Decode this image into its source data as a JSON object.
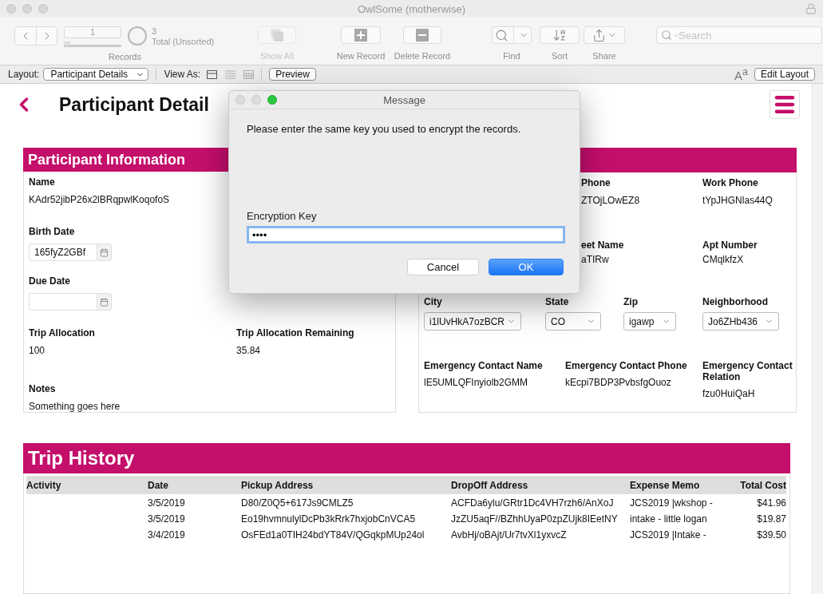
{
  "window": {
    "title": "OwlSome (motherwise)"
  },
  "toolbar": {
    "record_number": "1",
    "slider": {
      "level": 0
    },
    "found_count": "3",
    "found_status": "Total (Unsorted)",
    "records_label": "Records",
    "buttons": [
      {
        "kind": "show_all",
        "label": "Show All",
        "disabled": true
      },
      {
        "kind": "new_record",
        "label": "New Record",
        "disabled": false
      },
      {
        "kind": "delete_record",
        "label": "Delete Record",
        "disabled": false
      },
      {
        "kind": "find",
        "label": "Find",
        "disabled": false
      },
      {
        "kind": "sort",
        "label": "Sort",
        "disabled": false
      },
      {
        "kind": "share",
        "label": "Share",
        "disabled": false
      }
    ],
    "search": {
      "placeholder": "Search"
    }
  },
  "layout_bar": {
    "layout_label": "Layout:",
    "layout": "Participant Details",
    "view_as_label": "View As:",
    "view_modes": [
      {
        "kind": "form",
        "selected": true
      },
      {
        "kind": "list",
        "selected": false
      },
      {
        "kind": "table",
        "selected": false
      }
    ],
    "preview_button": "Preview",
    "text_size": "A$^{a}$",
    "edit_layout_button": "Edit Layout"
  },
  "page": {
    "title": "Participant Detail"
  },
  "participant_information": {
    "title": "Participant Information",
    "name": {
      "label": "Name",
      "value": "KAdr52jibP26x2lBRqpwlKoqofoS"
    },
    "birth_date": {
      "label": "Birth Date",
      "value": "165fyZ2GBf"
    },
    "due_date": {
      "label": "Due Date"
    },
    "trip_allocation": {
      "label": "Trip Allocation",
      "value": "100"
    },
    "trip_allocation_remaining": {
      "label": "Trip Allocation Remaining",
      "value": "35.84"
    },
    "notes": {
      "label": "Notes",
      "value": "Something goes here"
    }
  },
  "contact_information": {
    "row_1": [
      {
        "label": "Phone",
        "value": "ZTOjLOwEZ8"
      },
      {
        "label": "Work Phone",
        "value": "tYpJHGNlas44Q"
      }
    ],
    "row_2": [
      {
        "label": "eet Name",
        "value": "aTIRw"
      },
      {
        "label": "Apt Number",
        "value": "CMqlkfzX"
      }
    ],
    "address": [
      {
        "label": "City",
        "value": "i1lUvHkA7ozBCR"
      },
      {
        "label": "State",
        "value": "CO"
      },
      {
        "label": "Zip",
        "value": "igawp"
      },
      {
        "label": "Neighborhood",
        "value": "Jo6ZHb436"
      }
    ],
    "emergency_contact": [
      {
        "label": "Emergency Contact Name",
        "value": "lE5UMLQFInyiolb2GMM"
      },
      {
        "label": "Emergency Contact Phone",
        "value": "kEcpi7BDP3PvbsfgOuoz"
      },
      {
        "label": "Emergency Contact Relation",
        "value": "fzu0HuiQaH"
      }
    ]
  },
  "trip_history": {
    "title": "Trip History",
    "columns": [
      "Activity",
      "Date",
      "Pickup Address",
      "DropOff Address",
      "Expense Memo",
      "Total Cost"
    ],
    "rows": [
      {
        "date": "3/5/2019",
        "pickup": "D80/Z0Q5+617Js9CMLZ5",
        "dropoff": "ACFDa6ylu/GRtr1Dc4VH7rzh6/AnXoJ",
        "memo": "JCS2019 |wkshop -",
        "total": "$41.96"
      },
      {
        "date": "3/5/2019",
        "pickup": "Eo19hvmnulylDcPb3kRrk7hxjobCnVCA5",
        "dropoff": "JzZU5aqF//BZhhUyaP0zpZUjk8IEetNY",
        "memo": "intake - little logan",
        "total": "$19.87"
      },
      {
        "date": "3/4/2019",
        "pickup": "OsFEd1a0TIH24bdYT84V/QGqkpMUp24ol",
        "dropoff": "AvbHj/oBAjt/Ur7tvXl1yxvcZ",
        "memo": "JCS2019 |Intake -",
        "total": "$39.50"
      }
    ]
  },
  "dialog": {
    "title": "Message",
    "message": "Please enter the same key you used to encrypt the records.",
    "field_label": "Encryption Key",
    "field_value": "••••",
    "buttons": [
      {
        "label": "Cancel",
        "default": false
      },
      {
        "label": "OK",
        "default": true
      }
    ]
  }
}
